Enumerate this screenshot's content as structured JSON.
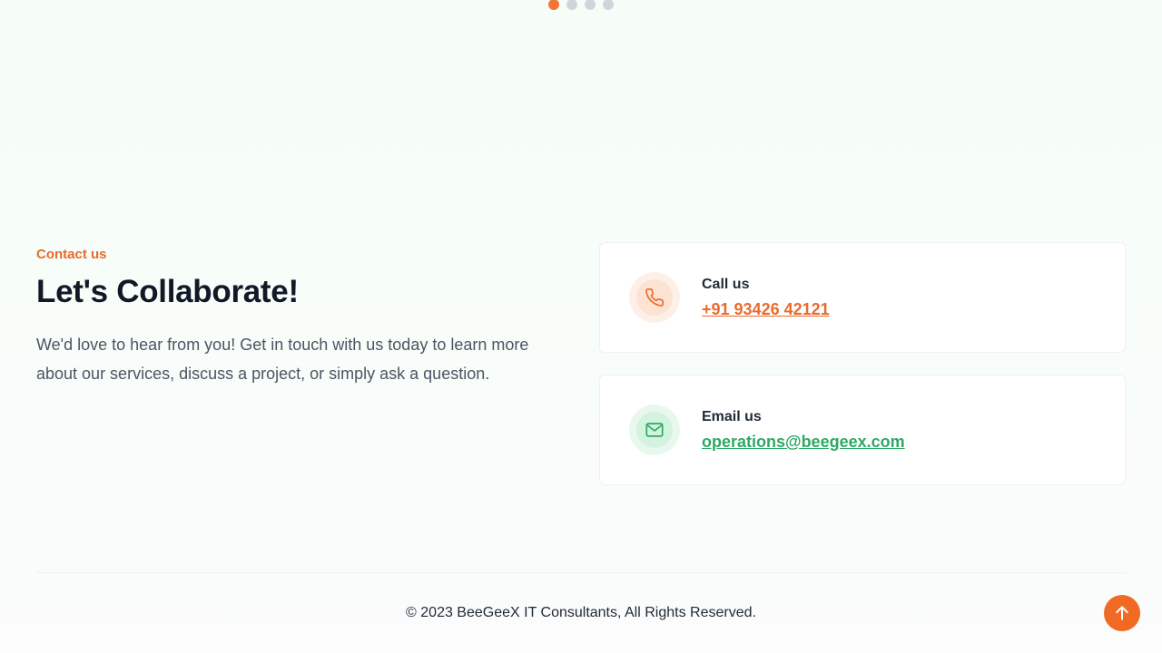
{
  "carousel": {
    "dots": [
      {
        "active": true
      },
      {
        "active": false
      },
      {
        "active": false
      },
      {
        "active": false
      }
    ]
  },
  "contact": {
    "eyebrow": "Contact us",
    "heading": "Let's Collaborate!",
    "description": "We'd love to hear from you! Get in touch with us today to learn more about our services, discuss a project, or simply ask a question."
  },
  "cards": {
    "call": {
      "label": "Call us",
      "value": "+91 93426 42121",
      "icon": "phone-icon"
    },
    "email": {
      "label": "Email us",
      "value": "operations@beegeex.com",
      "icon": "mail-icon"
    }
  },
  "footer": {
    "copyright": "© 2023 BeeGeeX IT Consultants, All Rights Reserved."
  },
  "colors": {
    "accent_orange": "#f06a24",
    "accent_green": "#2fa865",
    "heading": "#111827"
  },
  "scroll_top": {
    "icon": "arrow-up-icon"
  }
}
